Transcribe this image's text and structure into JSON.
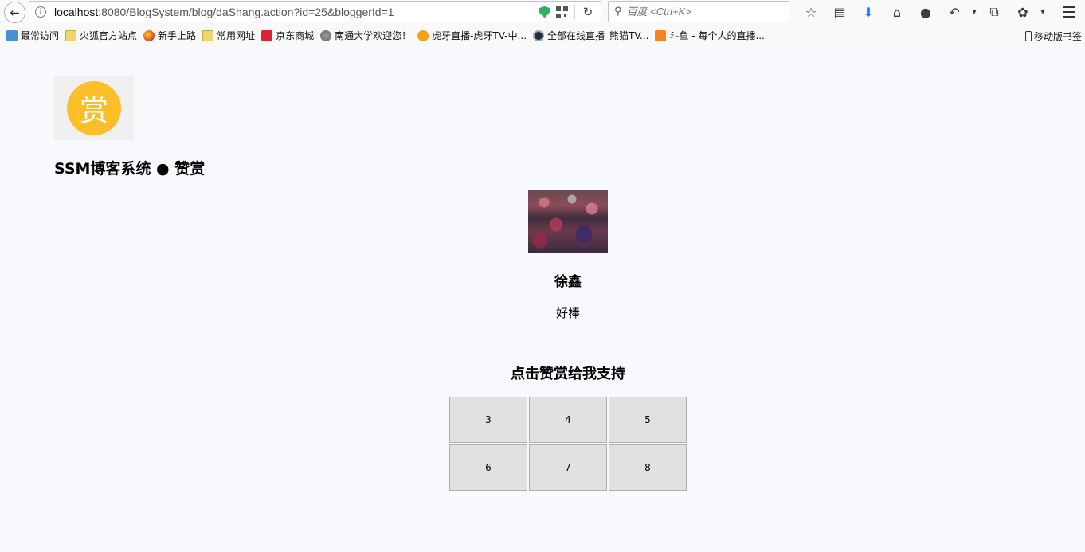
{
  "browser": {
    "url_host": "localhost",
    "url_rest": ":8080/BlogSystem/blog/daShang.action?id=25&bloggerId=1",
    "search_placeholder": "百度 <Ctrl+K>",
    "bookmarks": [
      {
        "label": "最常访问",
        "icon": "most-visited-icon"
      },
      {
        "label": "火狐官方站点",
        "icon": "folder-icon"
      },
      {
        "label": "新手上路",
        "icon": "firefox-icon"
      },
      {
        "label": "常用网址",
        "icon": "folder-icon"
      },
      {
        "label": "京东商城",
        "icon": "jd-icon"
      },
      {
        "label": "南通大学欢迎您！",
        "icon": "globe-icon"
      },
      {
        "label": "虎牙直播-虎牙TV-中...",
        "icon": "huya-icon"
      },
      {
        "label": "全部在线直播_熊猫TV...",
        "icon": "panda-icon"
      },
      {
        "label": "斗鱼 - 每个人的直播...",
        "icon": "douyu-icon"
      }
    ],
    "mobile_bookmarks": "移动版书签"
  },
  "page": {
    "logo_char": "赏",
    "site_title": "SSM博客系统 ● 赞赏",
    "blogger_name": "徐鑫",
    "blogger_sign": "好棒",
    "support_title": "点击赞赏给我支持",
    "amounts": [
      "3",
      "4",
      "5",
      "6",
      "7",
      "8"
    ],
    "logo_color": "#fcbf2a"
  }
}
